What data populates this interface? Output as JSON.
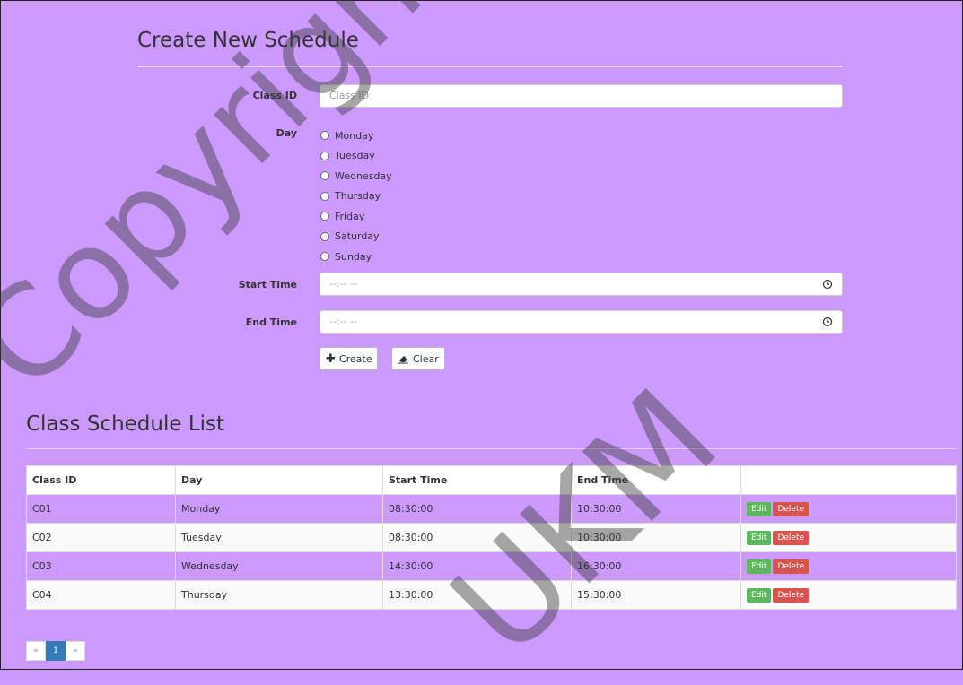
{
  "form": {
    "title": "Create New Schedule",
    "class_id_label": "Class ID",
    "class_id_placeholder": "Class ID",
    "day_label": "Day",
    "days": [
      "Monday",
      "Tuesday",
      "Wednesday",
      "Thursday",
      "Friday",
      "Saturday",
      "Sunday"
    ],
    "start_time_label": "Start Time",
    "start_time_value": "--:-- --",
    "end_time_label": "End Time",
    "end_time_value": "--:-- --",
    "create_label": "Create",
    "clear_label": "Clear"
  },
  "list": {
    "title": "Class Schedule List",
    "headers": [
      "Class ID",
      "Day",
      "Start Time",
      "End Time",
      ""
    ],
    "rows": [
      {
        "class_id": "C01",
        "day": "Monday",
        "start": "08:30:00",
        "end": "10:30:00"
      },
      {
        "class_id": "C02",
        "day": "Tuesday",
        "start": "08:30:00",
        "end": "10:30:00"
      },
      {
        "class_id": "C03",
        "day": "Wednesday",
        "start": "14:30:00",
        "end": "16:30:00"
      },
      {
        "class_id": "C04",
        "day": "Thursday",
        "start": "13:30:00",
        "end": "15:30:00"
      }
    ],
    "edit_label": "Edit",
    "delete_label": "Delete"
  },
  "pager": {
    "prev": "«",
    "current": "1",
    "next": "»"
  },
  "watermark": {
    "line1": "Copyright@FTSM",
    "line2": "UKM"
  },
  "colors": {
    "background": "#cc99ff",
    "edit": "#5cb85c",
    "delete": "#d9534f",
    "pager_active": "#337ab7"
  }
}
